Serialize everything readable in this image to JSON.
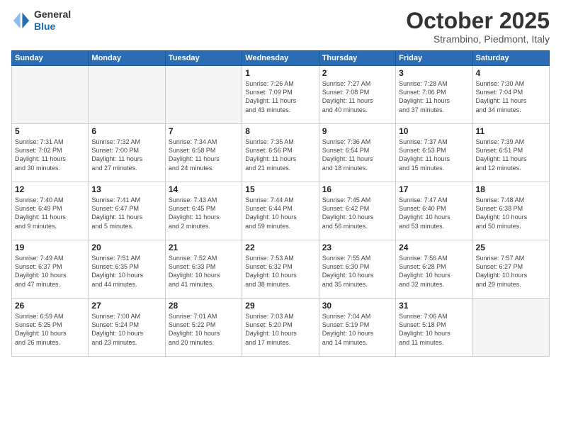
{
  "header": {
    "logo_line1": "General",
    "logo_line2": "Blue",
    "month": "October 2025",
    "location": "Strambino, Piedmont, Italy"
  },
  "weekdays": [
    "Sunday",
    "Monday",
    "Tuesday",
    "Wednesday",
    "Thursday",
    "Friday",
    "Saturday"
  ],
  "weeks": [
    [
      {
        "day": "",
        "info": ""
      },
      {
        "day": "",
        "info": ""
      },
      {
        "day": "",
        "info": ""
      },
      {
        "day": "1",
        "info": "Sunrise: 7:26 AM\nSunset: 7:09 PM\nDaylight: 11 hours\nand 43 minutes."
      },
      {
        "day": "2",
        "info": "Sunrise: 7:27 AM\nSunset: 7:08 PM\nDaylight: 11 hours\nand 40 minutes."
      },
      {
        "day": "3",
        "info": "Sunrise: 7:28 AM\nSunset: 7:06 PM\nDaylight: 11 hours\nand 37 minutes."
      },
      {
        "day": "4",
        "info": "Sunrise: 7:30 AM\nSunset: 7:04 PM\nDaylight: 11 hours\nand 34 minutes."
      }
    ],
    [
      {
        "day": "5",
        "info": "Sunrise: 7:31 AM\nSunset: 7:02 PM\nDaylight: 11 hours\nand 30 minutes."
      },
      {
        "day": "6",
        "info": "Sunrise: 7:32 AM\nSunset: 7:00 PM\nDaylight: 11 hours\nand 27 minutes."
      },
      {
        "day": "7",
        "info": "Sunrise: 7:34 AM\nSunset: 6:58 PM\nDaylight: 11 hours\nand 24 minutes."
      },
      {
        "day": "8",
        "info": "Sunrise: 7:35 AM\nSunset: 6:56 PM\nDaylight: 11 hours\nand 21 minutes."
      },
      {
        "day": "9",
        "info": "Sunrise: 7:36 AM\nSunset: 6:54 PM\nDaylight: 11 hours\nand 18 minutes."
      },
      {
        "day": "10",
        "info": "Sunrise: 7:37 AM\nSunset: 6:53 PM\nDaylight: 11 hours\nand 15 minutes."
      },
      {
        "day": "11",
        "info": "Sunrise: 7:39 AM\nSunset: 6:51 PM\nDaylight: 11 hours\nand 12 minutes."
      }
    ],
    [
      {
        "day": "12",
        "info": "Sunrise: 7:40 AM\nSunset: 6:49 PM\nDaylight: 11 hours\nand 9 minutes."
      },
      {
        "day": "13",
        "info": "Sunrise: 7:41 AM\nSunset: 6:47 PM\nDaylight: 11 hours\nand 5 minutes."
      },
      {
        "day": "14",
        "info": "Sunrise: 7:43 AM\nSunset: 6:45 PM\nDaylight: 11 hours\nand 2 minutes."
      },
      {
        "day": "15",
        "info": "Sunrise: 7:44 AM\nSunset: 6:44 PM\nDaylight: 10 hours\nand 59 minutes."
      },
      {
        "day": "16",
        "info": "Sunrise: 7:45 AM\nSunset: 6:42 PM\nDaylight: 10 hours\nand 56 minutes."
      },
      {
        "day": "17",
        "info": "Sunrise: 7:47 AM\nSunset: 6:40 PM\nDaylight: 10 hours\nand 53 minutes."
      },
      {
        "day": "18",
        "info": "Sunrise: 7:48 AM\nSunset: 6:38 PM\nDaylight: 10 hours\nand 50 minutes."
      }
    ],
    [
      {
        "day": "19",
        "info": "Sunrise: 7:49 AM\nSunset: 6:37 PM\nDaylight: 10 hours\nand 47 minutes."
      },
      {
        "day": "20",
        "info": "Sunrise: 7:51 AM\nSunset: 6:35 PM\nDaylight: 10 hours\nand 44 minutes."
      },
      {
        "day": "21",
        "info": "Sunrise: 7:52 AM\nSunset: 6:33 PM\nDaylight: 10 hours\nand 41 minutes."
      },
      {
        "day": "22",
        "info": "Sunrise: 7:53 AM\nSunset: 6:32 PM\nDaylight: 10 hours\nand 38 minutes."
      },
      {
        "day": "23",
        "info": "Sunrise: 7:55 AM\nSunset: 6:30 PM\nDaylight: 10 hours\nand 35 minutes."
      },
      {
        "day": "24",
        "info": "Sunrise: 7:56 AM\nSunset: 6:28 PM\nDaylight: 10 hours\nand 32 minutes."
      },
      {
        "day": "25",
        "info": "Sunrise: 7:57 AM\nSunset: 6:27 PM\nDaylight: 10 hours\nand 29 minutes."
      }
    ],
    [
      {
        "day": "26",
        "info": "Sunrise: 6:59 AM\nSunset: 5:25 PM\nDaylight: 10 hours\nand 26 minutes."
      },
      {
        "day": "27",
        "info": "Sunrise: 7:00 AM\nSunset: 5:24 PM\nDaylight: 10 hours\nand 23 minutes."
      },
      {
        "day": "28",
        "info": "Sunrise: 7:01 AM\nSunset: 5:22 PM\nDaylight: 10 hours\nand 20 minutes."
      },
      {
        "day": "29",
        "info": "Sunrise: 7:03 AM\nSunset: 5:20 PM\nDaylight: 10 hours\nand 17 minutes."
      },
      {
        "day": "30",
        "info": "Sunrise: 7:04 AM\nSunset: 5:19 PM\nDaylight: 10 hours\nand 14 minutes."
      },
      {
        "day": "31",
        "info": "Sunrise: 7:06 AM\nSunset: 5:18 PM\nDaylight: 10 hours\nand 11 minutes."
      },
      {
        "day": "",
        "info": ""
      }
    ]
  ]
}
